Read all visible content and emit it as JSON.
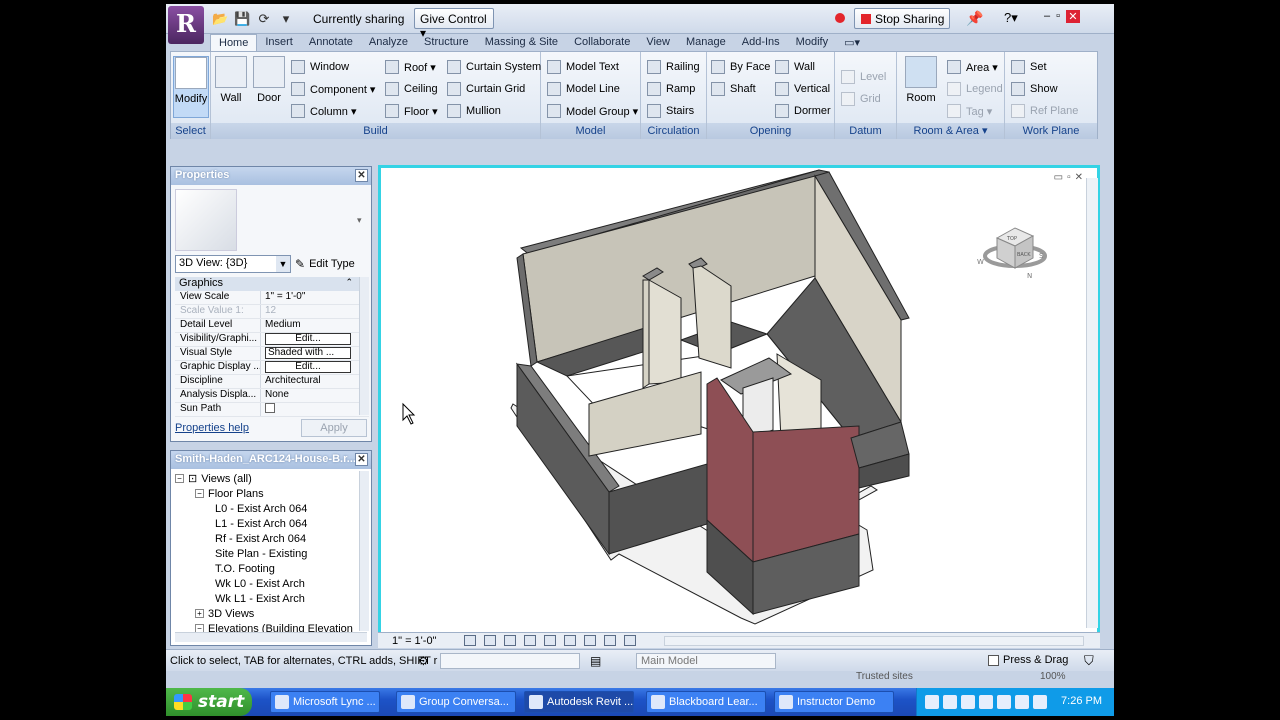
{
  "sharing_bar": {
    "status": "Currently sharing",
    "give_control": "Give Control ▾",
    "stop_sharing": "Stop Sharing",
    "help": "?▾",
    "win_min": "–",
    "win_max": "▫",
    "win_close": "✕"
  },
  "ribbon": {
    "tabs": [
      "Home",
      "Insert",
      "Annotate",
      "Analyze",
      "Structure",
      "Massing & Site",
      "Collaborate",
      "View",
      "Manage",
      "Add-Ins",
      "Modify"
    ],
    "tab_extra": "▭▾",
    "panels": {
      "select": "Select",
      "build": "Build",
      "model": "Model",
      "circulation": "Circulation",
      "opening": "Opening",
      "datum": "Datum",
      "room_area": "Room & Area ▾",
      "work_plane": "Work Plane"
    },
    "buttons": {
      "modify": "Modify",
      "wall": "Wall",
      "door": "Door",
      "window": "Window",
      "component": "Component ▾",
      "column": "Column ▾",
      "roof": "Roof ▾",
      "ceiling": "Ceiling",
      "floor": "Floor ▾",
      "curtain_system": "Curtain System",
      "curtain_grid": "Curtain Grid",
      "mullion": "Mullion",
      "model_text": "Model Text",
      "model_line": "Model Line",
      "model_group": "Model Group ▾",
      "railing": "Railing",
      "ramp": "Ramp",
      "stairs": "Stairs",
      "by_face": "By Face",
      "shaft": "Shaft",
      "wall_opening": "Wall",
      "vertical": "Vertical",
      "dormer": "Dormer",
      "level": "Level",
      "grid": "Grid",
      "room": "Room",
      "area": "Area ▾",
      "legend": "Legend",
      "tag": "Tag ▾",
      "set": "Set",
      "show": "Show",
      "ref_plane": "Ref Plane"
    }
  },
  "properties": {
    "title": "Properties",
    "type_selector": "3D View: {3D}",
    "edit_type": "Edit Type",
    "group": "Graphics",
    "rows": [
      {
        "key": "View Scale",
        "value": "1\" = 1'-0\""
      },
      {
        "key": "Scale Value    1:",
        "value": "12"
      },
      {
        "key": "Detail Level",
        "value": "Medium"
      },
      {
        "key": "Visibility/Graphi...",
        "value": "Edit..."
      },
      {
        "key": "Visual Style",
        "value": "Shaded with ..."
      },
      {
        "key": "Graphic Display ...",
        "value": "Edit..."
      },
      {
        "key": "Discipline",
        "value": "Architectural"
      },
      {
        "key": "Analysis Displa...",
        "value": "None"
      },
      {
        "key": "Sun Path",
        "value": ""
      }
    ],
    "help_link": "Properties help",
    "apply": "Apply"
  },
  "browser": {
    "title": "Smith-Haden_ARC124-House-B.r...",
    "items": [
      {
        "label": "Views (all)",
        "toggle": "−"
      },
      {
        "label": "Floor Plans",
        "toggle": "−"
      },
      {
        "label": "L0 - Exist Arch 064"
      },
      {
        "label": "L1 - Exist Arch 064"
      },
      {
        "label": "Rf - Exist Arch 064"
      },
      {
        "label": "Site Plan - Existing"
      },
      {
        "label": "T.O. Footing"
      },
      {
        "label": "Wk L0 - Exist Arch"
      },
      {
        "label": "Wk L1 - Exist Arch"
      },
      {
        "label": "3D Views",
        "toggle": "+"
      },
      {
        "label": "Elevations (Building Elevation",
        "toggle": "−"
      }
    ]
  },
  "view": {
    "scale": "1\" = 1'-0\"",
    "controls": "▭▫✕",
    "viewcube_top": "TOP",
    "viewcube_front": "BACK",
    "compass": {
      "w": "W",
      "s": "S",
      "n": "N"
    },
    "colors": {
      "accent_wall": "#8e4f55",
      "frame": "#34d3e5"
    }
  },
  "status": {
    "message": "Click to select, TAB for alternates, CTRL adds, SHIFT r",
    "workset": "Main Model",
    "press_drag": "Press & Drag",
    "trusted": "Trusted sites",
    "zoom": "100%"
  },
  "taskbar": {
    "start": "start",
    "tasks": [
      "Microsoft Lync   ...",
      "Group Conversa...",
      "Autodesk Revit ...",
      "Blackboard Lear...",
      "Instructor Demo"
    ],
    "clock": "7:26 PM"
  }
}
